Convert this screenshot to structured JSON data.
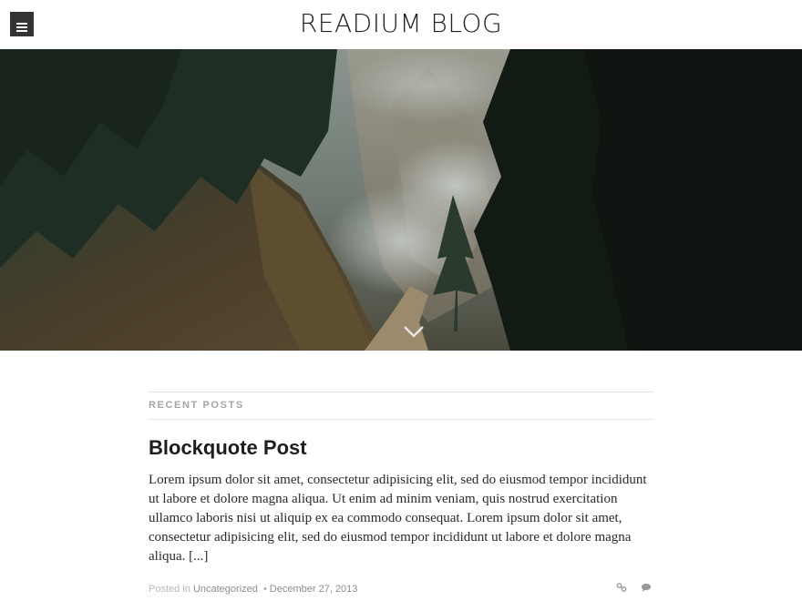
{
  "header": {
    "site_title": "READIUM BLOG",
    "menu_icon": "hamburger-icon"
  },
  "hero": {
    "scroll_indicator_icon": "chevron-down-icon"
  },
  "section": {
    "heading": "RECENT POSTS"
  },
  "post": {
    "title": "Blockquote Post",
    "excerpt": "Lorem ipsum dolor sit amet, consectetur adipisicing elit, sed do eiusmod tempor incididunt ut labore et dolore magna aliqua. Ut enim ad minim veniam, quis nostrud exercitation ullamco laboris nisi ut aliquip ex ea commodo consequat. Lorem ipsum dolor sit amet, consectetur adipisicing elit, sed do eiusmod tempor incididunt ut labore et dolore magna aliqua. [...]",
    "meta": {
      "posted_in_label": "Posted in",
      "category": "Uncategorized",
      "separator": "•",
      "date": "December 27, 2013",
      "icons": [
        "link-icon",
        "comment-icon"
      ]
    }
  },
  "colors": {
    "menu_button": "#333333",
    "title_text": "#222222",
    "section_heading": "#a5a5a5",
    "rule": "#e3e3e3",
    "meta_text": "#b8b8b8",
    "meta_link": "#8c8c8c"
  }
}
